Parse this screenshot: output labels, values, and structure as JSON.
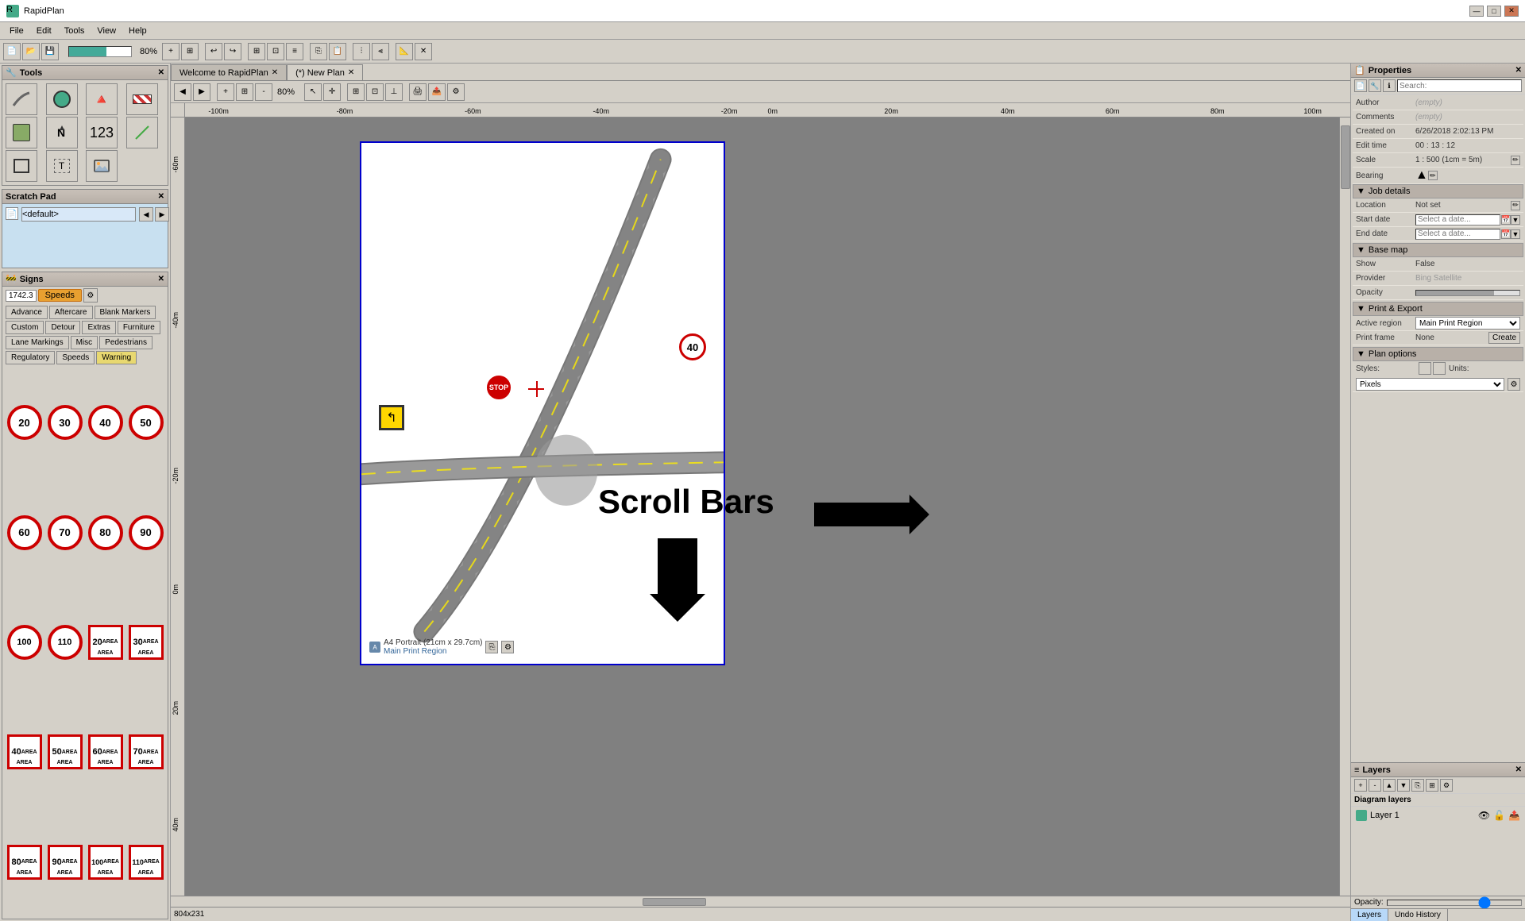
{
  "app": {
    "title": "RapidPlan",
    "icon": "R"
  },
  "titlebar": {
    "minimize_label": "—",
    "maximize_label": "□",
    "close_label": "✕"
  },
  "menu": {
    "items": [
      "File",
      "Edit",
      "Tools",
      "View",
      "Help"
    ]
  },
  "tabs": [
    {
      "label": "Welcome to RapidPlan",
      "active": false,
      "closable": true
    },
    {
      "label": "(*) New Plan",
      "active": true,
      "closable": true
    }
  ],
  "tools_panel": {
    "title": "Tools",
    "tools": [
      {
        "name": "road-tool",
        "icon": "⌒",
        "active": false
      },
      {
        "name": "shape-tool",
        "icon": "⬤",
        "active": false
      },
      {
        "name": "traffic-tool",
        "icon": "🔺",
        "active": false
      },
      {
        "name": "barrier-tool",
        "icon": "▬",
        "active": false
      },
      {
        "name": "terrain-tool",
        "icon": "◫",
        "active": false
      },
      {
        "name": "north-tool",
        "icon": "↑",
        "active": false
      },
      {
        "name": "text-tool",
        "icon": "123",
        "active": false
      },
      {
        "name": "line-tool",
        "icon": "/",
        "active": false
      },
      {
        "name": "rect-tool",
        "icon": "□",
        "active": false
      },
      {
        "name": "textbox-tool",
        "icon": "T",
        "active": false
      },
      {
        "name": "image-tool",
        "icon": "🖼",
        "active": false
      }
    ]
  },
  "scratch_pad": {
    "title": "Scratch Pad",
    "default_text": "<default>"
  },
  "signs_panel": {
    "title": "Signs",
    "count": "1742.3",
    "category": "Speeds",
    "categories": [
      "Advance",
      "Aftercare",
      "Blank Markers",
      "Custom",
      "Detour",
      "Extras",
      "Furniture",
      "Lane Markings",
      "Misc",
      "Pedestrians",
      "Regulatory",
      "Speeds",
      "Warning"
    ],
    "speeds": [
      20,
      30,
      40,
      50,
      60,
      70,
      80,
      90,
      100,
      110
    ],
    "speed_areas": [
      20,
      30,
      40,
      50,
      60,
      70,
      80,
      90,
      100,
      110
    ]
  },
  "canvas": {
    "zoom": "80%",
    "page_label": "A4 Portrait (21cm x 29.7cm)",
    "print_region_label": "Main Print Region",
    "size_label": "804x231",
    "ruler": {
      "marks": [
        "-100m",
        "-80m",
        "-60m",
        "-40m",
        "-20m",
        "0m",
        "20m",
        "40m",
        "60m",
        "80m",
        "100m"
      ]
    }
  },
  "annotation": {
    "scroll_bars_label": "Scroll Bars",
    "arrow_right": "➡"
  },
  "properties": {
    "title": "Properties",
    "search_placeholder": "Search:",
    "author_label": "Author",
    "author_value": "(empty)",
    "comments_label": "Comments",
    "comments_value": "(empty)",
    "created_on_label": "Created on",
    "created_on_value": "6/26/2018 2:02:13 PM",
    "edit_time_label": "Edit time",
    "edit_time_value": "00 : 13 : 12",
    "scale_label": "Scale",
    "scale_value": "1 : 500  (1cm = 5m)",
    "bearing_label": "Bearing",
    "bearing_value": "▲",
    "job_details_label": "Job details",
    "location_label": "Location",
    "location_value": "Not set",
    "start_date_label": "Start date",
    "start_date_placeholder": "Select a date...",
    "end_date_label": "End date",
    "end_date_placeholder": "Select a date...",
    "base_map_label": "Base map",
    "show_label": "Show",
    "show_value": "False",
    "provider_label": "Provider",
    "provider_value": "Bing Satellite",
    "opacity_label": "Opacity",
    "opacity_value": "0.75",
    "print_export_label": "Print & Export",
    "active_region_label": "Active region",
    "active_region_value": "Main Print Region",
    "print_frame_label": "Print frame",
    "print_frame_value": "None",
    "create_label": "Create",
    "plan_options_label": "Plan options",
    "styles_label": "Styles:",
    "units_label": "Units:",
    "units_value": "Pixels"
  },
  "layers": {
    "title": "Layers",
    "diagram_layers_label": "Diagram layers",
    "layer1_name": "Layer 1",
    "tabs": [
      "Layers",
      "Undo History"
    ]
  },
  "opacity_bar": {
    "label": "Opacity:",
    "value": 0.75
  },
  "status": {
    "size": "804x231"
  }
}
